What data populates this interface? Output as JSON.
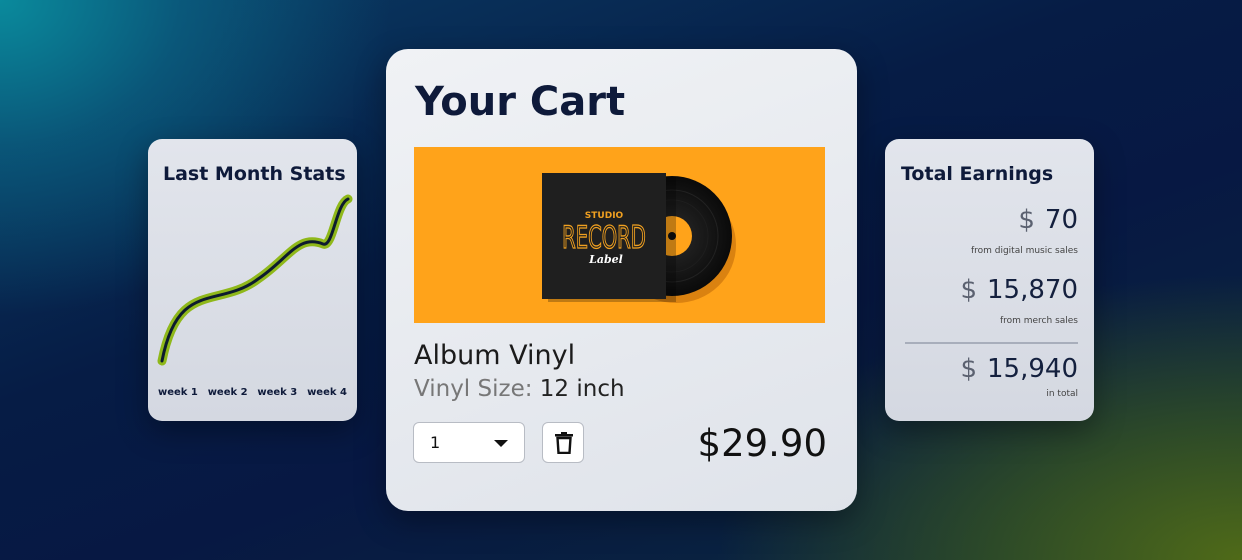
{
  "stats_card": {
    "title": "Last Month Stats",
    "weeks": [
      "week 1",
      "week 2",
      "week 3",
      "week 4"
    ]
  },
  "cart": {
    "title": "Your Cart",
    "banner": {
      "studio": "STUDIO",
      "record": "RECORD",
      "label": "Label"
    },
    "product_name": "Album Vinyl",
    "size_label": "Vinyl Size:",
    "size_value": "12 inch",
    "quantity": "1",
    "price": "$29.90"
  },
  "earnings": {
    "title": "Total Earnings",
    "currency": "$",
    "items": [
      {
        "amount": "70",
        "note": "from digital music sales"
      },
      {
        "amount": "15,870",
        "note": "from merch sales"
      },
      {
        "amount": "15,940",
        "note": "in total"
      }
    ]
  },
  "colors": {
    "banner": "#ffa31a",
    "line_outline": "#8fb81a",
    "line_core": "#0d1b2e",
    "heading": "#0e1a3a"
  }
}
